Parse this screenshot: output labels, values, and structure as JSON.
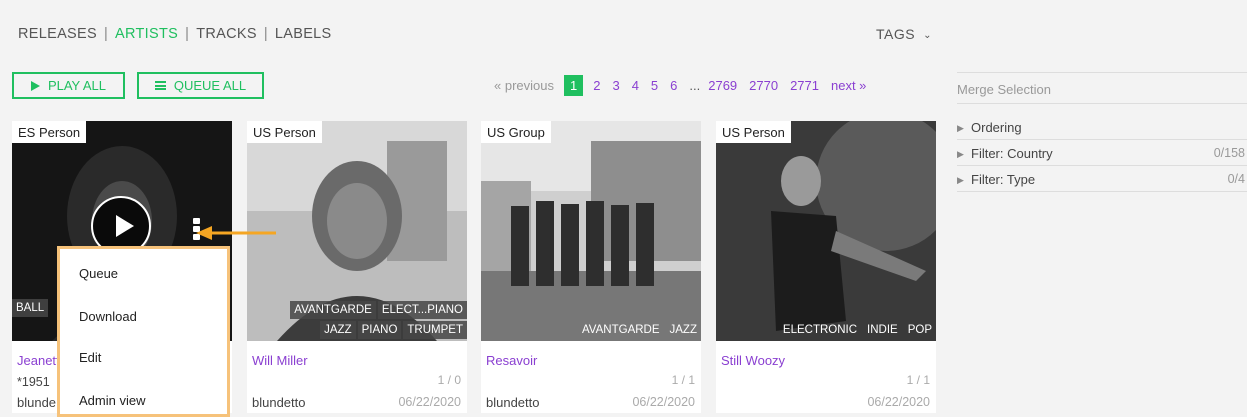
{
  "nav": {
    "items": [
      "RELEASES",
      "ARTISTS",
      "TRACKS",
      "LABELS"
    ],
    "active": "ARTISTS",
    "tags_label": "TAGS"
  },
  "actions": {
    "play_all": "PLAY ALL",
    "queue_all": "QUEUE ALL"
  },
  "pagination": {
    "previous": "« previous",
    "current": "1",
    "pages": [
      "2",
      "3",
      "4",
      "5",
      "6"
    ],
    "ellipsis": "...",
    "last_pages": [
      "2769",
      "2770",
      "2771"
    ],
    "next": "next »"
  },
  "sidebar": {
    "merge_placeholder": "Merge Selection",
    "sections": [
      {
        "label": "Ordering",
        "value": ""
      },
      {
        "label": "Filter: Country",
        "value": "0/158"
      },
      {
        "label": "Filter: Type",
        "value": "0/4"
      }
    ]
  },
  "cards": [
    {
      "country_type": "ES Person",
      "tags_row1": [
        "BALL"
      ],
      "tags_row2": [],
      "name": "Jeanett",
      "year": "*1951",
      "count": "",
      "user": "blunde",
      "date": ""
    },
    {
      "country_type": "US Person",
      "tags_row1": [
        "AVANTGARDE",
        "ELECT...PIANO"
      ],
      "tags_row2": [
        "JAZZ",
        "PIANO",
        "TRUMPET"
      ],
      "name": "Will Miller",
      "year": "",
      "count": "1 / 0",
      "user": "blundetto",
      "date": "06/22/2020"
    },
    {
      "country_type": "US Group",
      "tags_row1": [],
      "tags_row2": [
        "AVANTGARDE",
        "JAZZ"
      ],
      "name": "Resavoir",
      "year": "",
      "count": "1 / 1",
      "user": "blundetto",
      "date": "06/22/2020"
    },
    {
      "country_type": "US Person",
      "tags_row1": [],
      "tags_row2": [
        "ELECTRONIC",
        "INDIE",
        "POP"
      ],
      "name": "Still Woozy",
      "year": "",
      "count": "1 / 1",
      "user": "",
      "date": "06/22/2020"
    }
  ],
  "context_menu": {
    "items": [
      "Queue",
      "Download",
      "Edit",
      "Admin view"
    ]
  },
  "colors": {
    "accent": "#1fbf5f",
    "link": "#8a3fd1",
    "highlight": "#f6c27a",
    "arrow": "#f5a623"
  }
}
